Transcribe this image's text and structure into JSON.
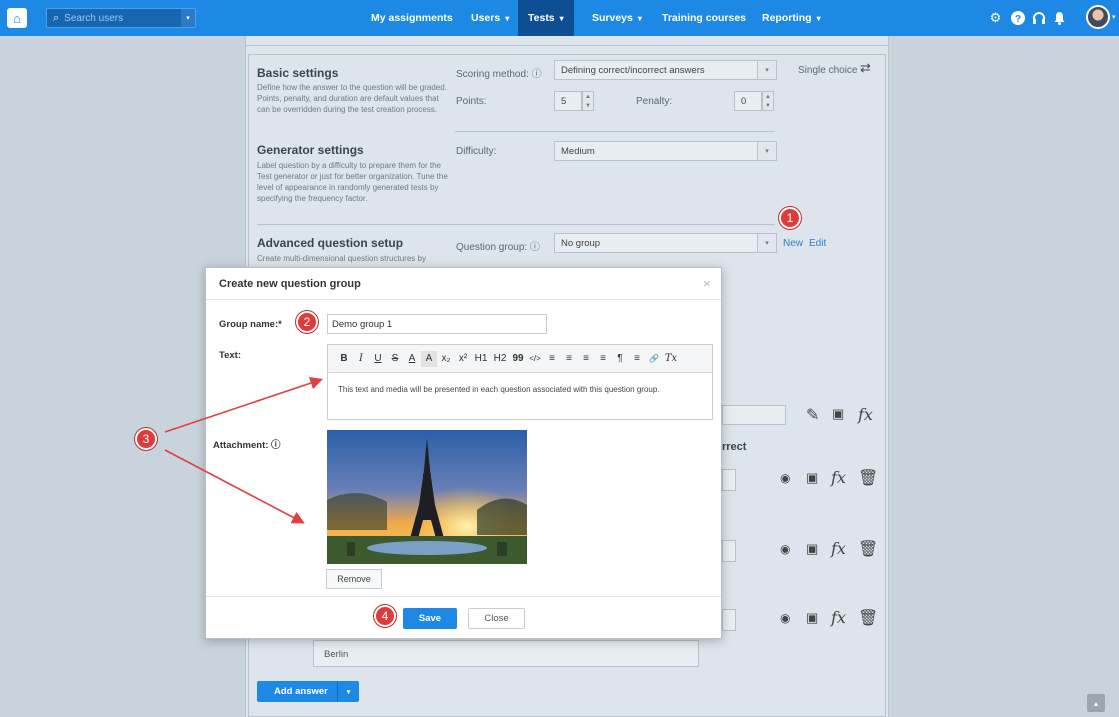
{
  "nav": {
    "search_placeholder": "Search users",
    "items": [
      {
        "label": "My assignments",
        "caret": ""
      },
      {
        "label": "Users",
        "caret": "▾"
      },
      {
        "label": "Tests",
        "caret": "▾"
      },
      {
        "label": "Surveys",
        "caret": "▾"
      },
      {
        "label": "Training courses",
        "caret": ""
      },
      {
        "label": "Reporting",
        "caret": "▾"
      }
    ],
    "icons": [
      "home-icon",
      "search-icon",
      "gear-icon",
      "help-icon",
      "headset-icon",
      "bell-icon"
    ],
    "accent": "#1e88e5"
  },
  "basic": {
    "title": "Basic settings",
    "desc": "Define how the answer to the question will be graded. Points, penalty, and duration are default values that can be overridden during the test creation process.",
    "scoring_label": "Scoring method: ⓘ",
    "scoring_value": "Defining correct/incorrect answers",
    "type_label": "Single choice",
    "points_label": "Points:",
    "points_value": "5",
    "penalty_label": "Penalty:",
    "penalty_value": "0"
  },
  "generator": {
    "title": "Generator settings",
    "desc": "Label question by a difficulty to prepare them for the Test generator or just for better organization. Tune the level of appearance in randomly generated tests by specifying the frequency factor.",
    "difficulty_label": "Difficulty:",
    "difficulty_value": "Medium"
  },
  "advanced": {
    "title": "Advanced question setup",
    "desc": "Create multi-dimensional question structures by",
    "group_label": "Question group: ⓘ",
    "group_value": "No group",
    "new_link": "New",
    "edit_link": "Edit"
  },
  "answers": {
    "correct_header": "rrect",
    "last_answer": "Berlin",
    "add_answer": "Add answer"
  },
  "modal": {
    "title": "Create new question group",
    "close_symbol": "×",
    "group_name_label": "Group name:*",
    "group_name_value": "Demo group 1",
    "text_label": "Text:",
    "editor_text": "This text and media will be presented in each question associated with this question group.",
    "toolbar": [
      "B",
      "I",
      "U",
      "S",
      "A",
      "A",
      "x₂",
      "x²",
      "H1",
      "H2",
      "99",
      "</>",
      "≡",
      "≡",
      "≡",
      "≡",
      "¶",
      "≡",
      "🔗",
      "Tx"
    ],
    "attachment_label": "Attachment: ⓘ",
    "remove_label": "Remove",
    "save_label": "Save",
    "close_label": "Close"
  },
  "callouts": [
    "1",
    "2",
    "3",
    "4"
  ]
}
